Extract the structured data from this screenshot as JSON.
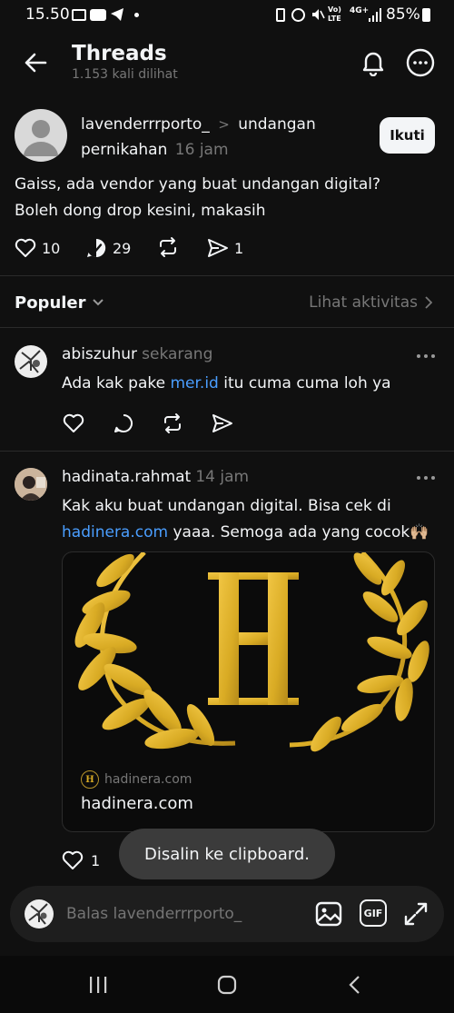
{
  "status_bar": {
    "time": "15.50",
    "battery": "85%",
    "network": "4G+",
    "volte": "Vo) LTE"
  },
  "header": {
    "title": "Threads",
    "views": "1.153 kali dilihat"
  },
  "post": {
    "author": "lavenderrrporto_",
    "separator": ">",
    "community": "undangan",
    "community_cont": "pernikahan",
    "time": "16 jam",
    "follow_label": "Ikuti",
    "text_line1": "Gaiss, ada vendor yang buat undangan digital?",
    "text_line2": "Boleh dong drop kesini, makasih",
    "likes": "10",
    "replies": "29",
    "shares": "1"
  },
  "sort": {
    "label": "Populer",
    "activity": "Lihat aktivitas"
  },
  "replies": [
    {
      "author": "abiszuhur",
      "time": "sekarang",
      "text_pre": "Ada kak pake ",
      "link": "mer.id",
      "text_post": " itu cuma cuma loh ya"
    },
    {
      "author": "hadinata.rahmat",
      "time": "14 jam",
      "text_line1": "Kak aku buat undangan digital. Bisa cek di",
      "link": "hadinera.com",
      "text_post": " yaaa. Semoga ada yang cocok🙌🏼",
      "card_site": "hadinera.com",
      "card_title": "hadinera.com",
      "logo_letter": "H",
      "likes": "1"
    }
  ],
  "toast": "Disalin ke clipboard.",
  "composer": {
    "placeholder": "Balas lavenderrrporto_",
    "gif": "GIF"
  },
  "colors": {
    "background": "#101010",
    "link": "#4a9eff",
    "gold": "#d9ab24",
    "muted": "#777777"
  }
}
